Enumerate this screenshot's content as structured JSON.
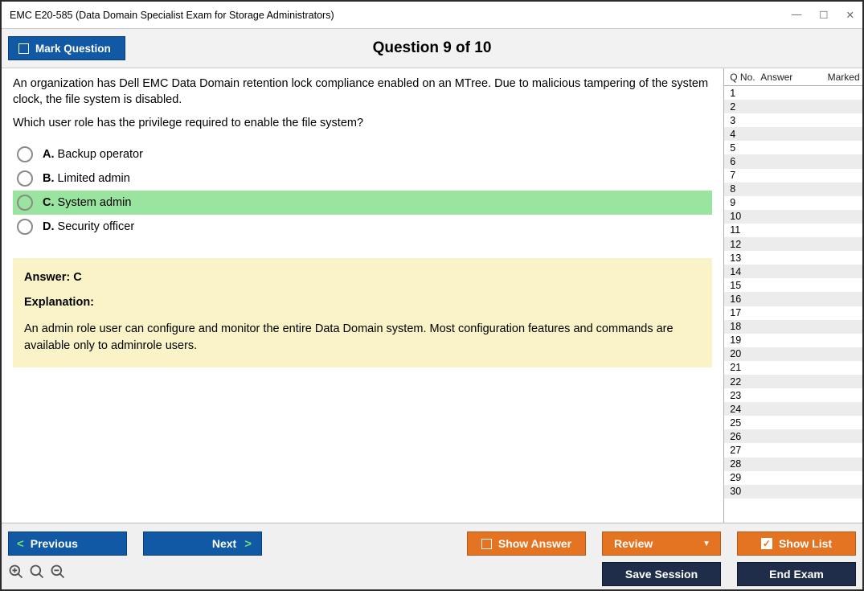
{
  "window": {
    "title": "EMC E20-585 (Data Domain Specialist Exam for Storage Administrators)"
  },
  "header": {
    "mark_label": "Mark Question",
    "question_title": "Question 9 of 10"
  },
  "question": {
    "text_line1": "An organization has Dell EMC Data Domain retention lock compliance enabled on an MTree. Due to malicious tampering of the system clock, the file system is disabled.",
    "text_line2": "Which user role has the privilege required to enable the file system?",
    "options": [
      {
        "letter": "A.",
        "text": "Backup operator",
        "selected": false
      },
      {
        "letter": "B.",
        "text": "Limited admin",
        "selected": false
      },
      {
        "letter": "C.",
        "text": "System admin",
        "selected": true
      },
      {
        "letter": "D.",
        "text": "Security officer",
        "selected": false
      }
    ]
  },
  "answer_box": {
    "answer_label": "Answer: C",
    "explanation_label": "Explanation:",
    "explanation_text": "An admin role user can configure and monitor the entire Data Domain system. Most configuration features and commands are available only to adminrole users."
  },
  "right_panel": {
    "col_q": "Q No.",
    "col_a": "Answer",
    "col_m": "Marked",
    "rows": [
      {
        "q": "1",
        "a": "",
        "m": ""
      },
      {
        "q": "2",
        "a": "",
        "m": ""
      },
      {
        "q": "3",
        "a": "",
        "m": ""
      },
      {
        "q": "4",
        "a": "",
        "m": ""
      },
      {
        "q": "5",
        "a": "",
        "m": ""
      },
      {
        "q": "6",
        "a": "",
        "m": ""
      },
      {
        "q": "7",
        "a": "",
        "m": ""
      },
      {
        "q": "8",
        "a": "",
        "m": ""
      },
      {
        "q": "9",
        "a": "",
        "m": ""
      },
      {
        "q": "10",
        "a": "",
        "m": ""
      },
      {
        "q": "11",
        "a": "",
        "m": ""
      },
      {
        "q": "12",
        "a": "",
        "m": ""
      },
      {
        "q": "13",
        "a": "",
        "m": ""
      },
      {
        "q": "14",
        "a": "",
        "m": ""
      },
      {
        "q": "15",
        "a": "",
        "m": ""
      },
      {
        "q": "16",
        "a": "",
        "m": ""
      },
      {
        "q": "17",
        "a": "",
        "m": ""
      },
      {
        "q": "18",
        "a": "",
        "m": ""
      },
      {
        "q": "19",
        "a": "",
        "m": ""
      },
      {
        "q": "20",
        "a": "",
        "m": ""
      },
      {
        "q": "21",
        "a": "",
        "m": ""
      },
      {
        "q": "22",
        "a": "",
        "m": ""
      },
      {
        "q": "23",
        "a": "",
        "m": ""
      },
      {
        "q": "24",
        "a": "",
        "m": ""
      },
      {
        "q": "25",
        "a": "",
        "m": ""
      },
      {
        "q": "26",
        "a": "",
        "m": ""
      },
      {
        "q": "27",
        "a": "",
        "m": ""
      },
      {
        "q": "28",
        "a": "",
        "m": ""
      },
      {
        "q": "29",
        "a": "",
        "m": ""
      },
      {
        "q": "30",
        "a": "",
        "m": ""
      }
    ]
  },
  "footer": {
    "previous": "Previous",
    "next": "Next",
    "show_answer": "Show Answer",
    "review": "Review",
    "show_list": "Show List",
    "save_session": "Save Session",
    "end_exam": "End Exam"
  }
}
